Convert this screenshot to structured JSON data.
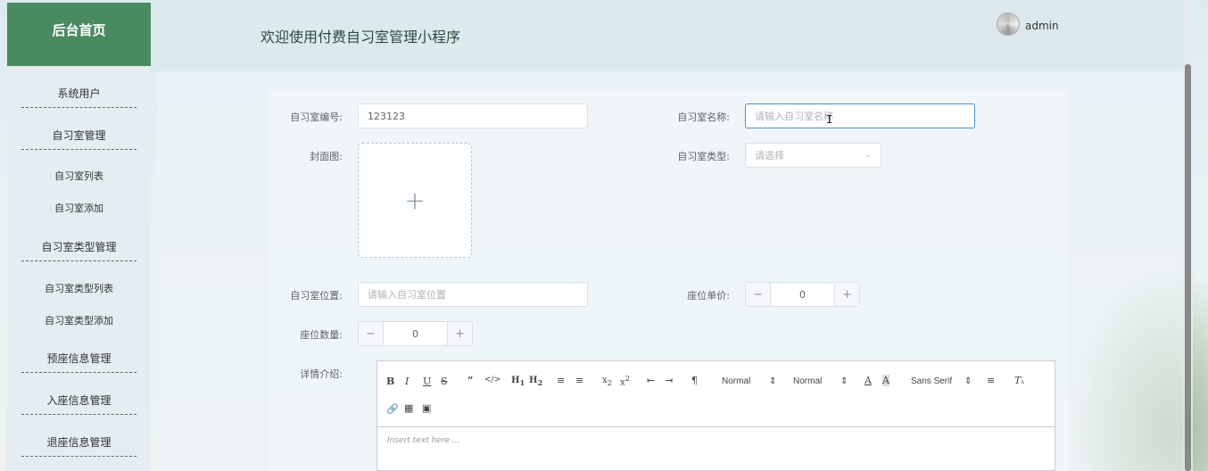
{
  "sidebar": {
    "title": "后台首页",
    "items": [
      {
        "label": "系统用户",
        "kind": "group"
      },
      {
        "label": "自习室管理",
        "kind": "group"
      },
      {
        "label": "自习室列表",
        "kind": "sub"
      },
      {
        "label": "自习室添加",
        "kind": "sub"
      },
      {
        "label": "自习室类型管理",
        "kind": "group"
      },
      {
        "label": "自习室类型列表",
        "kind": "sub"
      },
      {
        "label": "自习室类型添加",
        "kind": "sub"
      },
      {
        "label": "预座信息管理",
        "kind": "group"
      },
      {
        "label": "入座信息管理",
        "kind": "group"
      },
      {
        "label": "退座信息管理",
        "kind": "group"
      }
    ]
  },
  "header": {
    "app_title": "欢迎使用付费自习室管理小程序",
    "username": "admin"
  },
  "form": {
    "room_no_label": "自习室编号:",
    "room_no_value": "123123",
    "room_name_label": "自习室名称:",
    "room_name_placeholder": "请输入自习室名称",
    "cover_label": "封面图:",
    "room_type_label": "自习室类型:",
    "room_type_placeholder": "请选择",
    "location_label": "自习室位置:",
    "location_placeholder": "请输入自习室位置",
    "seat_price_label": "座位单价:",
    "seat_price_value": "0",
    "seat_count_label": "座位数量:",
    "seat_count_value": "0",
    "detail_label": "详情介绍:"
  },
  "editor": {
    "header_select": "Normal",
    "size_select": "Normal",
    "font_select": "Sans Serif",
    "placeholder": "Insert text here ..."
  }
}
